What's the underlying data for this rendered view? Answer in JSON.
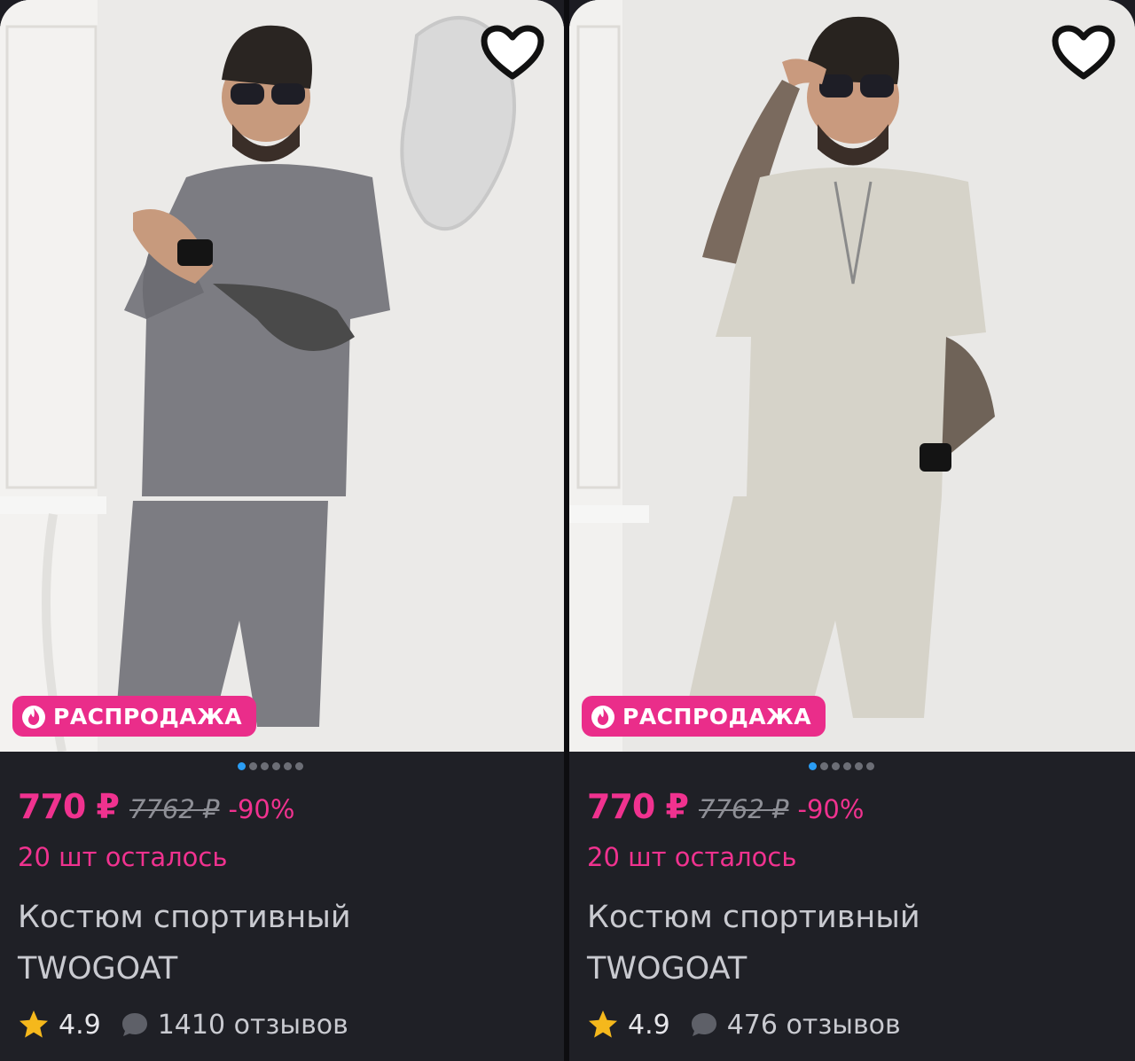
{
  "products": [
    {
      "badge": "РАСПРОДАЖА",
      "price": "770 ₽",
      "old_price": "7762 ₽",
      "discount": "-90%",
      "stock": "20 шт осталось",
      "title_line1": "Костюм спортивный",
      "title_line2": "TWOGOAT",
      "rating": "4.9",
      "reviews": "1410 отзывов",
      "photo_count": 6,
      "active_photo": 1,
      "outfit_color": "#7c7c82"
    },
    {
      "badge": "РАСПРОДАЖА",
      "price": "770 ₽",
      "old_price": "7762 ₽",
      "discount": "-90%",
      "stock": "20 шт осталось",
      "title_line1": "Костюм спортивный",
      "title_line2": "TWOGOAT",
      "rating": "4.9",
      "reviews": "476 отзывов",
      "photo_count": 6,
      "active_photo": 1,
      "outfit_color": "#d6d3c9"
    }
  ],
  "colors": {
    "accent_pink": "#f0328f",
    "badge_bg": "#ea2d8a",
    "card_bg": "#1f2026",
    "dot_active": "#2a9df4",
    "star": "#f5b81c"
  },
  "icons": [
    "heart-icon",
    "flame-icon",
    "star-icon",
    "comment-bubble-icon"
  ]
}
